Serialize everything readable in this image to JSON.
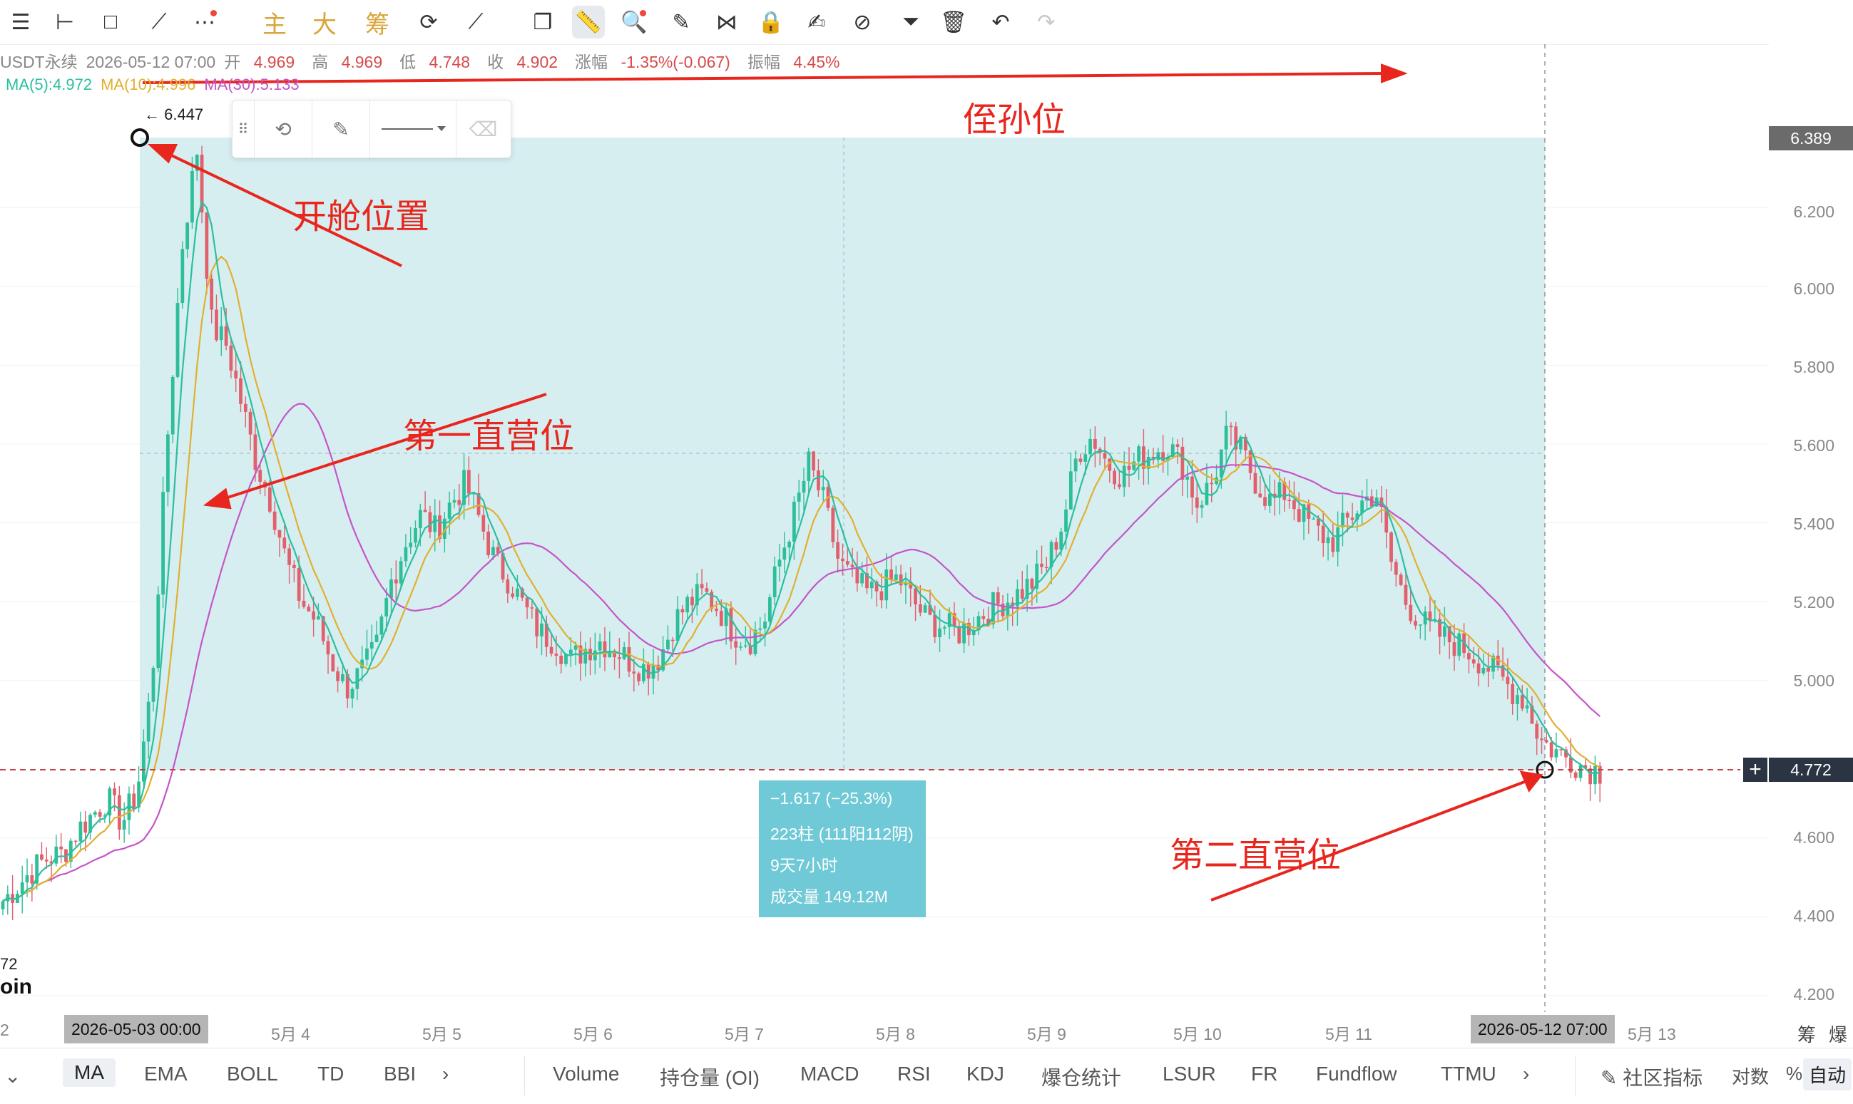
{
  "toolbar": {
    "gold_buttons": [
      "主",
      "大",
      "筹"
    ]
  },
  "info": {
    "symbol": "USDT永续",
    "datetime": "2026-05-12 07:00",
    "open_label": "开",
    "open": "4.969",
    "high_label": "高",
    "high": "4.969",
    "low_label": "低",
    "low": "4.748",
    "close_label": "收",
    "close": "4.902",
    "change_label": "涨幅",
    "change": "-1.35%(-0.067)",
    "amp_label": "振幅",
    "amp": "4.45%"
  },
  "ma": {
    "ma5": "MA(5):4.972",
    "ma10": "MA(10):4.996",
    "ma30": "MA(30):5.133"
  },
  "colors": {
    "ma5": "#2bbf9f",
    "ma10": "#e0b030",
    "ma30": "#c455c8",
    "up": "#2fbf98",
    "down": "#e0606c",
    "measure_fill": "#d7eef1",
    "annotation": "#e8261e"
  },
  "price_axis": {
    "labels": [
      "6.200",
      "6.000",
      "5.800",
      "5.600",
      "5.400",
      "5.200",
      "5.000",
      "4.600",
      "4.400",
      "4.200"
    ],
    "top_tag": "6.389",
    "current_tag": "4.772"
  },
  "high_marker": "← 6.447",
  "left_partial": {
    "value": "72",
    "word": "oin"
  },
  "time_axis": {
    "left_partial": "2",
    "start_tag": "2026-05-03 00:00",
    "labels": [
      "5月 4",
      "5月 5",
      "5月 6",
      "5月 7",
      "5月 8",
      "5月 9",
      "5月 10",
      "5月 11",
      "5月 13"
    ],
    "end_tag": "2026-05-12 07:00",
    "right": [
      "筹",
      "爆"
    ]
  },
  "measure": {
    "change": "−1.617 (−25.3%)",
    "bars": "223柱 (111阳112阴)",
    "duration": "9天7小时",
    "volume": "成交量 149.12M"
  },
  "annotations": {
    "top": "侄孙位",
    "open_pos": "开舱位置",
    "first": "第一直营位",
    "second": "第二直营位"
  },
  "bottom_bar": {
    "indicators": [
      "MA",
      "EMA",
      "BOLL",
      "TD",
      "BBI"
    ],
    "sub_indicators": [
      "Volume",
      "持仓量 (OI)",
      "MACD",
      "RSI",
      "KDJ",
      "爆仓统计",
      "LSUR",
      "FR",
      "Fundflow",
      "TTMU"
    ],
    "community": "社区指标",
    "log": "对数",
    "percent": "%",
    "auto": "自动"
  },
  "chart_data": {
    "type": "candlestick",
    "y_range": [
      4.2,
      6.45
    ],
    "y_ticks": [
      4.2,
      4.4,
      4.6,
      5.0,
      5.2,
      5.4,
      5.6,
      5.8,
      6.0,
      6.2
    ],
    "measure_from": 6.389,
    "measure_to": 4.772,
    "highlight_high": 6.447,
    "x_labels": [
      "2026-05-03 00:00",
      "5月 4",
      "5月 5",
      "5月 6",
      "5月 7",
      "5月 8",
      "5月 9",
      "5月 10",
      "5月 11",
      "2026-05-12 07:00",
      "5月 13"
    ],
    "trend_closes": [
      4.44,
      4.48,
      4.52,
      4.55,
      4.56,
      4.62,
      4.66,
      4.7,
      4.64,
      4.72,
      5.0,
      5.6,
      6.1,
      6.35,
      5.9,
      5.85,
      5.7,
      5.55,
      5.45,
      5.3,
      5.2,
      5.15,
      5.05,
      4.98,
      5.02,
      5.08,
      5.25,
      5.35,
      5.42,
      5.38,
      5.45,
      5.5,
      5.4,
      5.3,
      5.25,
      5.18,
      5.12,
      5.1,
      5.05,
      5.08,
      5.1,
      5.08,
      5.05,
      5.03,
      5.06,
      5.15,
      5.2,
      5.22,
      5.18,
      5.12,
      5.1,
      5.15,
      5.3,
      5.42,
      5.55,
      5.45,
      5.3,
      5.25,
      5.22,
      5.24,
      5.26,
      5.2,
      5.15,
      5.14,
      5.12,
      5.15,
      5.18,
      5.2,
      5.22,
      5.25,
      5.3,
      5.4,
      5.58,
      5.62,
      5.55,
      5.52,
      5.56,
      5.58,
      5.6,
      5.55,
      5.45,
      5.5,
      5.62,
      5.58,
      5.5,
      5.45,
      5.48,
      5.42,
      5.38,
      5.35,
      5.4,
      5.45,
      5.48,
      5.3,
      5.2,
      5.15,
      5.12,
      5.1,
      5.08,
      5.05,
      5.02,
      4.98,
      4.95,
      4.85,
      4.82,
      4.8,
      4.78,
      4.77
    ]
  }
}
